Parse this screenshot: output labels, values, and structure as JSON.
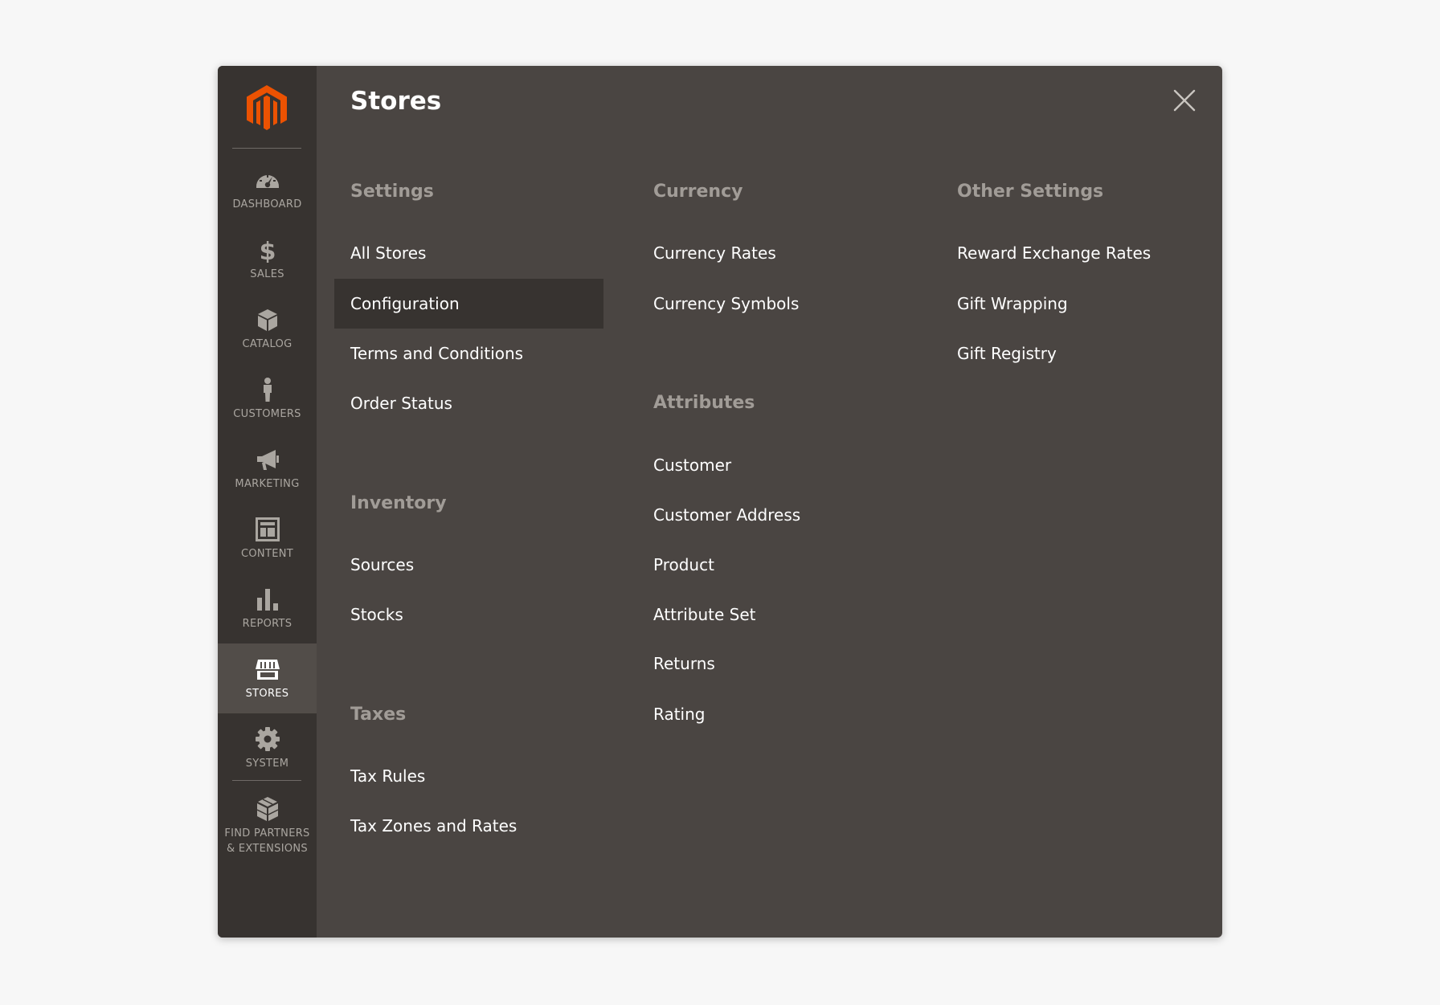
{
  "colors": {
    "page_background": "#f7f7f7",
    "panel_background": "#4a4542",
    "sidebar_background": "#373330",
    "active_item_background": "#524d49",
    "brand_orange": "#eb5202",
    "heading_gray": "#a19c97"
  },
  "sidebar": {
    "logo": "magento-logo-icon",
    "items": [
      {
        "id": "dashboard",
        "label": "DASHBOARD",
        "icon": "dashboard-gauge-icon"
      },
      {
        "id": "sales",
        "label": "SALES",
        "icon": "dollar-icon"
      },
      {
        "id": "catalog",
        "label": "CATALOG",
        "icon": "box-icon"
      },
      {
        "id": "customers",
        "label": "CUSTOMERS",
        "icon": "person-icon"
      },
      {
        "id": "marketing",
        "label": "MARKETING",
        "icon": "megaphone-icon"
      },
      {
        "id": "content",
        "label": "CONTENT",
        "icon": "layout-icon"
      },
      {
        "id": "reports",
        "label": "REPORTS",
        "icon": "bar-chart-icon"
      },
      {
        "id": "stores",
        "label": "STORES",
        "icon": "storefront-icon",
        "active": true
      },
      {
        "id": "system",
        "label": "SYSTEM",
        "icon": "gear-icon"
      },
      {
        "id": "partners",
        "label": "FIND PARTNERS\n& EXTENSIONS",
        "icon": "partners-boxes-icon"
      }
    ]
  },
  "panel": {
    "title": "Stores",
    "close_icon": "close-icon",
    "columns": [
      {
        "groups": [
          {
            "heading": "Settings",
            "items": [
              "All Stores",
              "Configuration",
              "Terms and Conditions",
              "Order Status"
            ],
            "selected_index": 1
          },
          {
            "heading": "Inventory",
            "items": [
              "Sources",
              "Stocks"
            ]
          },
          {
            "heading": "Taxes",
            "items": [
              "Tax Rules",
              "Tax Zones and Rates"
            ]
          }
        ]
      },
      {
        "groups": [
          {
            "heading": "Currency",
            "items": [
              "Currency Rates",
              "Currency Symbols"
            ]
          },
          {
            "heading": "Attributes",
            "items": [
              "Customer",
              "Customer Address",
              "Product",
              "Attribute Set",
              "Returns",
              "Rating"
            ]
          }
        ]
      },
      {
        "groups": [
          {
            "heading": "Other Settings",
            "items": [
              "Reward Exchange Rates",
              "Gift Wrapping",
              "Gift Registry"
            ]
          }
        ]
      }
    ]
  }
}
